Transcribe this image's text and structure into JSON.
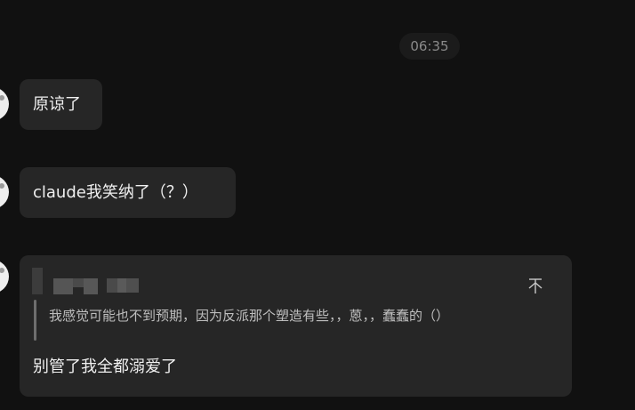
{
  "timestamp": "06:35",
  "messages": [
    {
      "text": "原谅了"
    },
    {
      "text": "claude我笑纳了（？）"
    },
    {
      "quote": {
        "text": "我感觉可能也不到预期，因为反派那个塑造有些，，蒽，，蠢蠢的（）"
      },
      "text": "别管了我全都溺爱了"
    }
  ],
  "icons": {
    "jump": "jump-to-quote-icon"
  },
  "colors": {
    "background": "#111111",
    "bubble": "#262626",
    "text": "#f0f0f0",
    "muted": "#8a8a8a"
  }
}
